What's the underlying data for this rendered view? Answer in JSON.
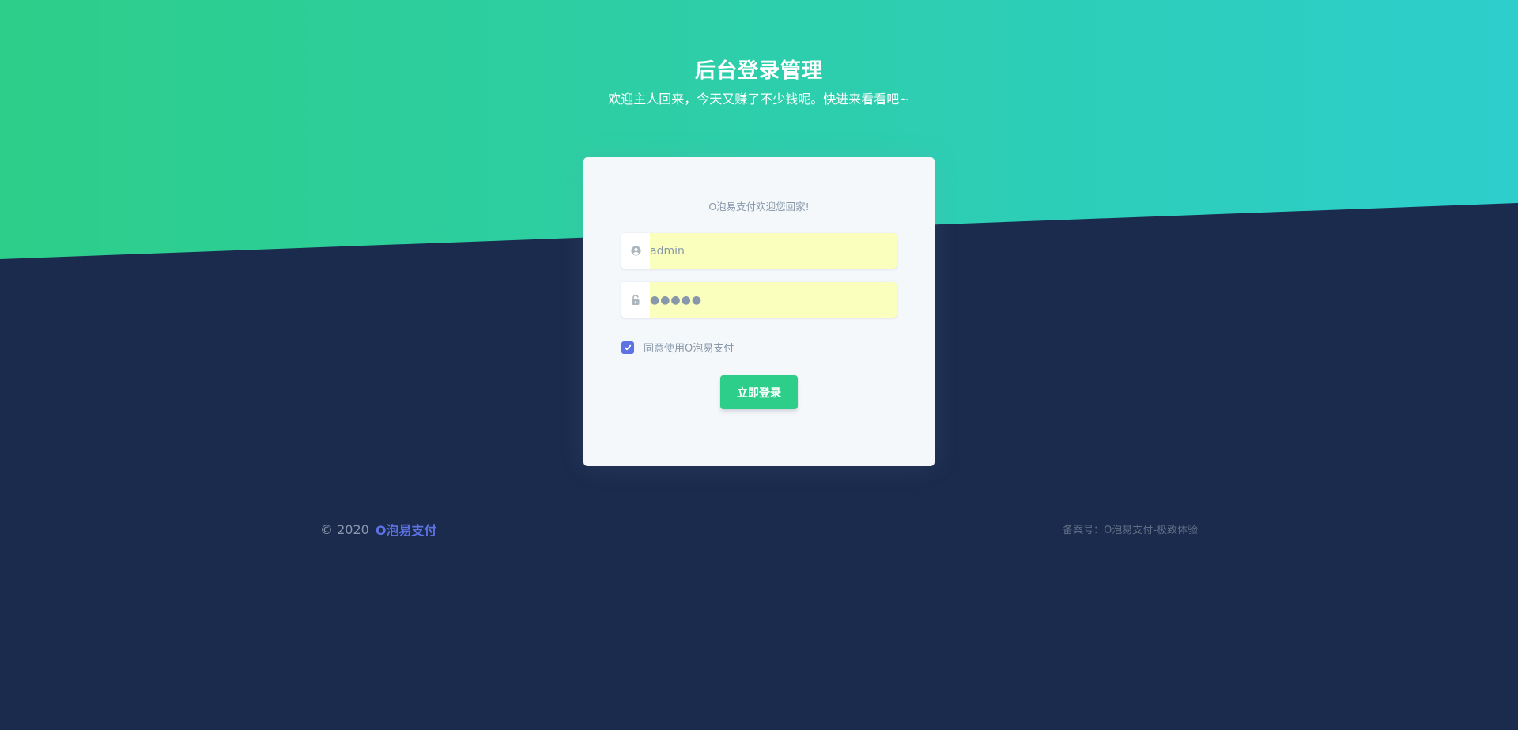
{
  "header": {
    "title": "后台登录管理",
    "subtitle": "欢迎主人回来，今天又赚了不少钱呢。快进来看看吧~"
  },
  "login": {
    "greeting": "O泡易支付欢迎您回家!",
    "username_value": "admin",
    "password_mask": "●●●●●",
    "agree_label": "同意使用O泡易支付",
    "agree_checked": true,
    "submit_label": "立即登录"
  },
  "footer": {
    "copyright": "© 2020",
    "brand": "O泡易支付",
    "icp": "备案号：O泡易支付-极致体验"
  },
  "colors": {
    "hero_start": "#2dce89",
    "hero_end": "#2dcecc",
    "background": "#1a2b4e",
    "primary": "#5e72e4",
    "success": "#2dce89"
  },
  "icons": {
    "username": "user-circle-icon",
    "password": "unlock-icon",
    "checkbox": "check-icon"
  }
}
